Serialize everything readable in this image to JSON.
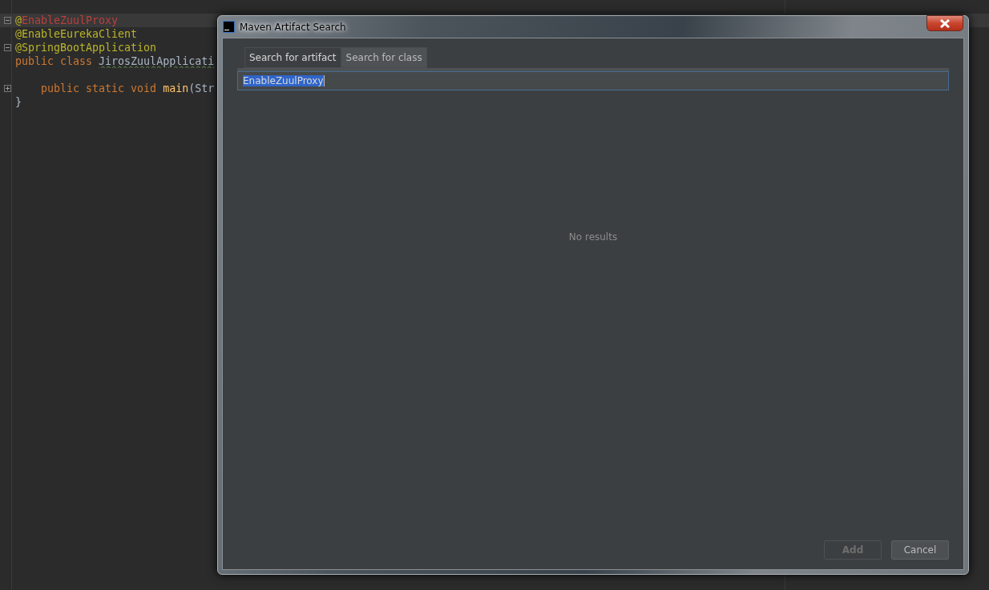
{
  "editor": {
    "lines": [
      {
        "current": true,
        "fold": {
          "expanded": true
        },
        "tokens": [
          {
            "text": "@",
            "kind": "annotation"
          },
          {
            "text": "EnableZuulProxy",
            "kind": "error"
          }
        ]
      },
      {
        "current": false,
        "tokens": [
          {
            "text": "@EnableEurekaClient",
            "kind": "annotation"
          }
        ]
      },
      {
        "current": false,
        "fold": {
          "expanded": true
        },
        "tokens": [
          {
            "text": "@SpringBootApplication",
            "kind": "annotation"
          }
        ]
      },
      {
        "current": false,
        "tokens": [
          {
            "text": "public class ",
            "kind": "keyword"
          },
          {
            "text": "JirosZuulApplicati",
            "kind": "typo"
          }
        ]
      },
      {
        "current": false
      },
      {
        "current": false,
        "fold": {
          "expanded": false
        },
        "tokens": [
          {
            "text": "    public static void ",
            "kind": "keyword"
          },
          {
            "text": "main",
            "kind": "method"
          },
          {
            "text": "(Str",
            "kind": "plain"
          }
        ]
      },
      {
        "current": false,
        "tokens": [
          {
            "text": "}",
            "kind": "plain"
          }
        ]
      }
    ]
  },
  "dialog": {
    "title": "Maven Artifact Search",
    "tabs": [
      {
        "label": "Search for artifact",
        "selected": true
      },
      {
        "label": "Search for class",
        "selected": false
      }
    ],
    "search": {
      "value": "EnableZuulProxy"
    },
    "empty_text": "No results",
    "buttons": [
      {
        "label": "Add",
        "disabled": true
      },
      {
        "label": "Cancel",
        "disabled": false
      }
    ]
  }
}
